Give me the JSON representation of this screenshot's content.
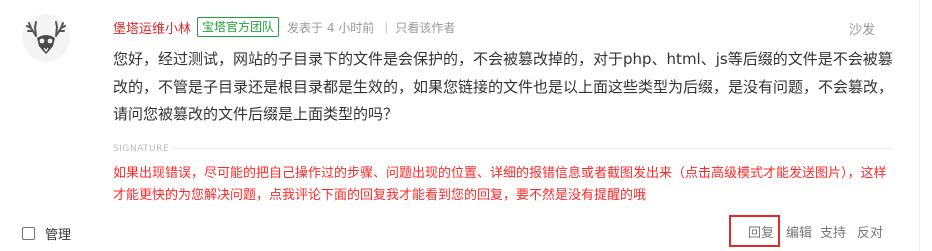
{
  "post": {
    "username": "堡塔运维小林",
    "badge": "宝塔官方团队",
    "time": "发表于 4 小时前",
    "only_author": "只看该作者",
    "floor": "沙发",
    "content": "您好，经过测试，网站的子目录下的文件是会保护的，不会被篡改掉的，对于php、html、js等后缀的文件是不会被篡改的，不管是子目录还是根目录都是生效的，如果您链接的文件也是以上面这些类型为后缀，是没有问题，不会篡改，请问您被篡改的文件后缀是上面类型的吗？",
    "signature_label": "SIGNATURE",
    "signature": "如果出现错误，尽可能的把自己操作过的步骤、问题出现的位置、详细的报错信息或者截图发出来（点击高级模式才能发送图片），这样才能更快的为您解决问题，点我评论下面的回复我才能看到您的回复，要不然是没有提醒的哦"
  },
  "footer": {
    "manage_label": "管理",
    "reply": "回复",
    "edit": "编辑",
    "support": "支持",
    "oppose": "反对"
  },
  "colors": {
    "username": "#d82a2a",
    "badge": "#20a53a",
    "signature": "#ff2a2a",
    "highlight_box": "#e02b2b"
  },
  "icons": {
    "avatar": "antler-skull-avatar"
  }
}
